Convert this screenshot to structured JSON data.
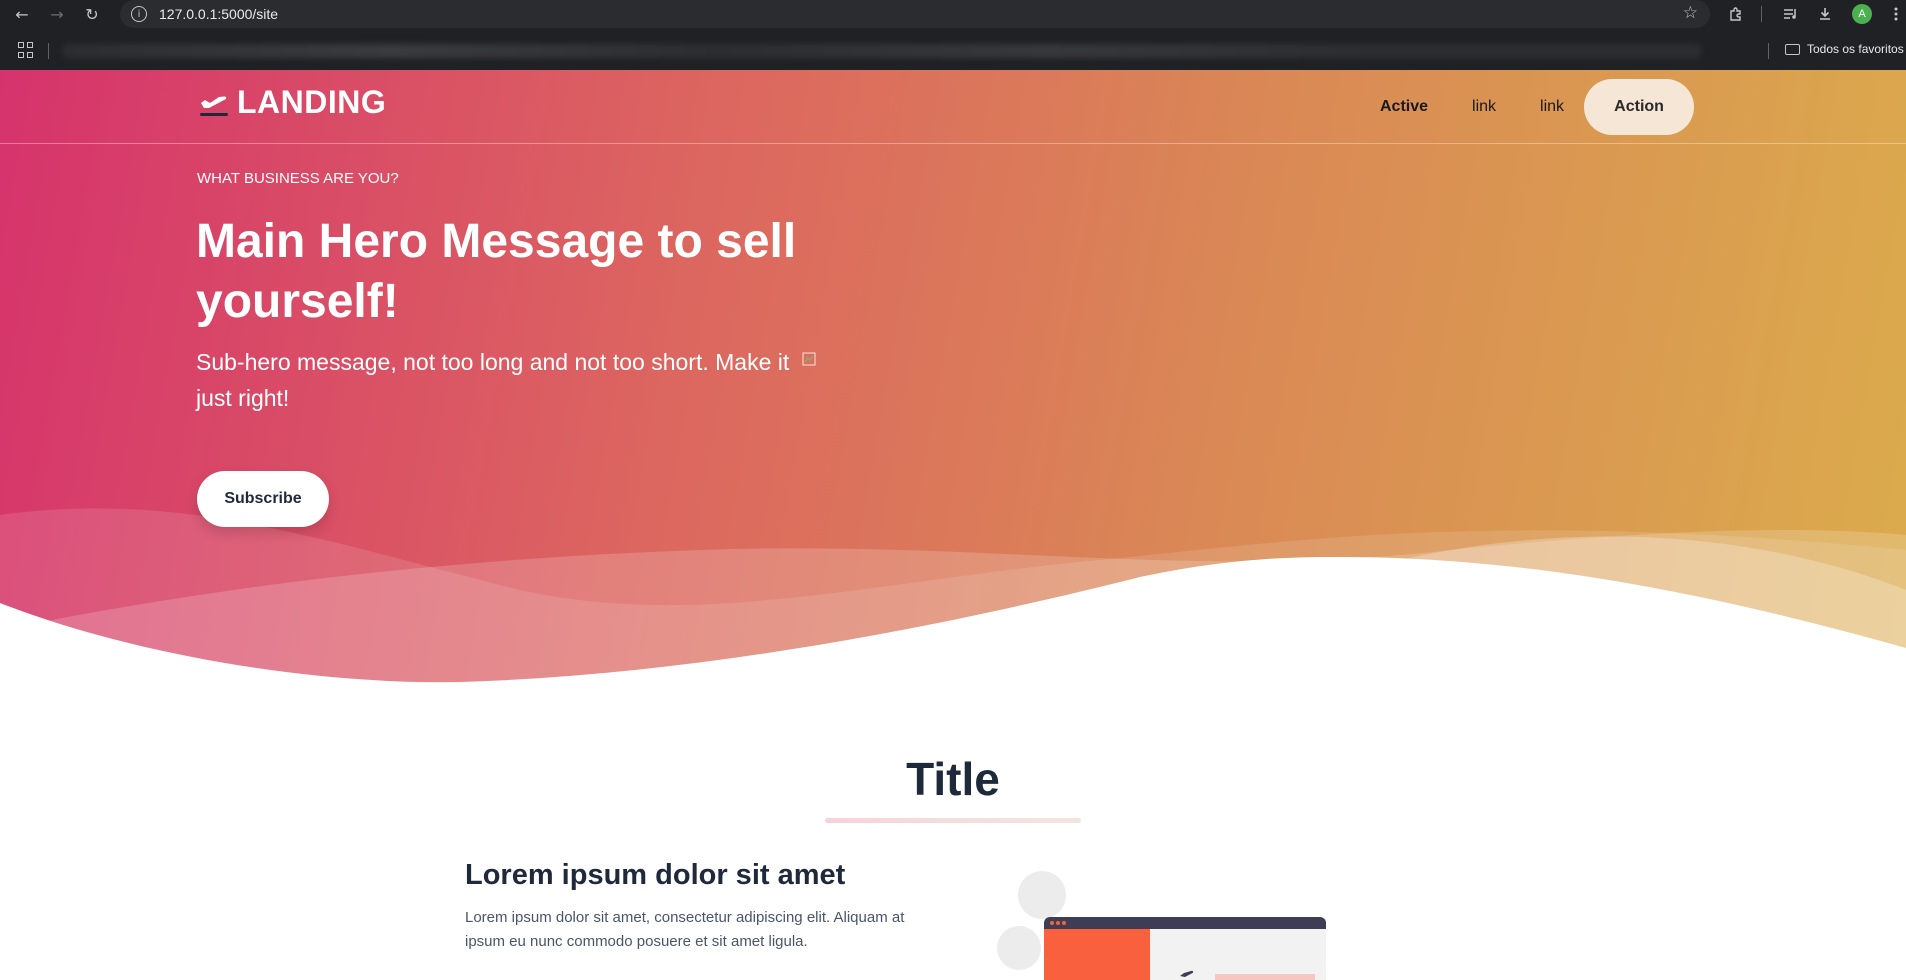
{
  "browser": {
    "url": "127.0.0.1:5000/site",
    "favorites_label": "Todos os favoritos",
    "profile_initial": "A"
  },
  "nav": {
    "logo_text": "LANDING",
    "links": [
      "Active",
      "link",
      "link"
    ],
    "action_label": "Action"
  },
  "hero": {
    "eyebrow": "WHAT BUSINESS ARE YOU?",
    "title": "Main Hero Message to sell yourself!",
    "subtitle": "Sub-hero message, not too long and not too short. Make it just right!",
    "cta_label": "Subscribe"
  },
  "section": {
    "title": "Title",
    "feature_heading": "Lorem ipsum dolor sit amet",
    "feature_text": "Lorem ipsum dolor sit amet, consectetur adipiscing elit. Aliquam at ipsum eu nunc commodo posuere et sit amet ligula."
  },
  "colors": {
    "hero_gradient_start": "#d6336c",
    "hero_gradient_end": "#dbac4c",
    "heading_text": "#1e2a3b",
    "action_button_bg": "#f6e6d6",
    "illustration_accent": "#f9603e"
  }
}
